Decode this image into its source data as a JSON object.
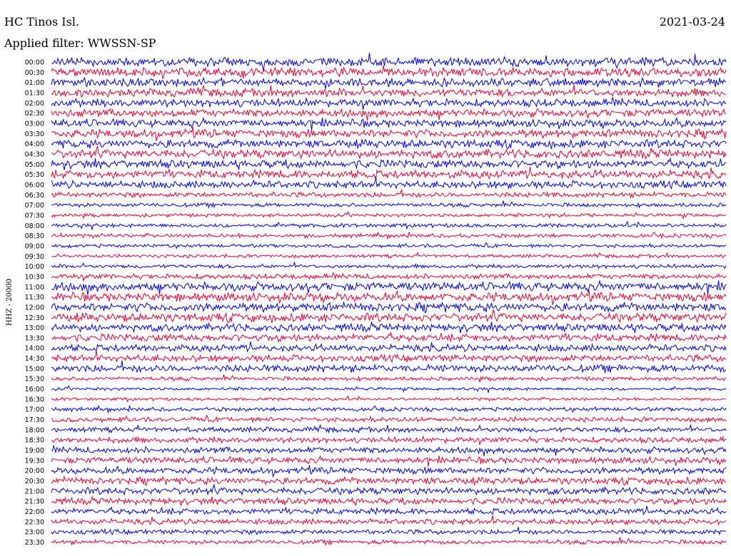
{
  "header": {
    "station": "HC Tinos Isl.",
    "filter_label": "Applied filter: WWSSN-SP",
    "date": "2021-03-24"
  },
  "chart_data": {
    "type": "line",
    "title": "HC Tinos Isl.",
    "subtitle": "Applied filter: WWSSN-SP",
    "date": "2021-03-24",
    "ylabel": "HHZ - 20000",
    "row_labels": [
      "00:00",
      "00:30",
      "01:00",
      "01:30",
      "02:00",
      "02:30",
      "03:00",
      "03:30",
      "04:00",
      "04:30",
      "05:00",
      "05:30",
      "06:00",
      "06:30",
      "07:00",
      "07:30",
      "08:00",
      "08:30",
      "09:00",
      "09:30",
      "10:00",
      "10:30",
      "11:00",
      "11:30",
      "12:00",
      "12:30",
      "13:00",
      "13:30",
      "14:00",
      "14:30",
      "15:00",
      "15:30",
      "16:00",
      "16:30",
      "17:00",
      "17:30",
      "18:00",
      "18:30",
      "19:00",
      "19:30",
      "20:00",
      "20:30",
      "21:00",
      "21:30",
      "22:00",
      "22:30",
      "23:00",
      "23:30"
    ],
    "colors": [
      "#0000ee",
      "#ee0033"
    ],
    "row_amplitude": [
      1.0,
      1.0,
      0.95,
      0.95,
      0.9,
      0.9,
      0.9,
      0.95,
      0.95,
      1.0,
      0.95,
      0.95,
      0.85,
      0.6,
      0.45,
      0.4,
      0.45,
      0.45,
      0.4,
      0.4,
      0.45,
      0.6,
      1.0,
      1.0,
      1.0,
      1.0,
      0.9,
      0.85,
      0.8,
      0.8,
      0.85,
      0.45,
      0.35,
      0.35,
      0.45,
      0.55,
      0.6,
      0.65,
      0.7,
      0.75,
      0.75,
      0.8,
      0.8,
      0.75,
      0.7,
      0.65,
      0.55,
      0.5
    ]
  }
}
